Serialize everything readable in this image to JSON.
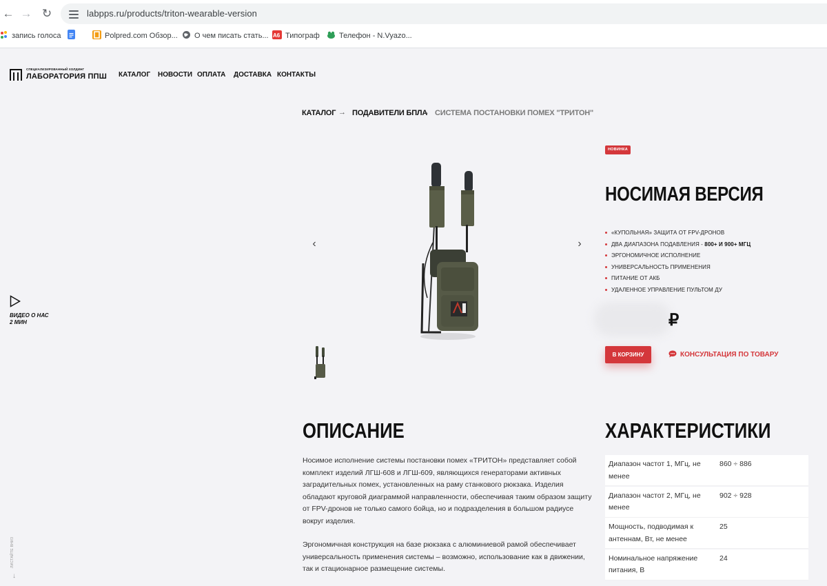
{
  "browser": {
    "url": "labpps.ru/products/triton-wearable-version",
    "bookmarks": [
      {
        "label": "запись голоса",
        "icon": "google-dots-icon"
      },
      {
        "label": "",
        "icon": "google-docs-icon"
      },
      {
        "label": "Polpred.com Обзор...",
        "icon": "polpred-icon"
      },
      {
        "label": "О чем писать стать...",
        "icon": "globe-icon"
      },
      {
        "label": "Типограф",
        "icon": "typograf-icon"
      },
      {
        "label": "Телефон - N.Vyazo...",
        "icon": "frog-icon"
      }
    ]
  },
  "site": {
    "logo_sub": "СПЕЦИАЛИЗИРОВАННЫЙ ХОЛДИНГ",
    "logo_name": "ЛАБОРАТОРИЯ ППШ",
    "menu": [
      "КАТАЛОГ",
      "НОВОСТИ",
      "ОПЛАТА",
      "ДОСТАВКА",
      "КОНТАКТЫ"
    ]
  },
  "breadcrumb": {
    "items": [
      "КАТАЛОГ",
      "ПОДАВИТЕЛИ БПЛА",
      "СИСТЕМА ПОСТАНОВКИ ПОМЕХ \"ТРИТОН\""
    ],
    "separator": "→"
  },
  "video": {
    "label_line1": "ВИДЕО О НАС",
    "label_line2": "2 МИН"
  },
  "scroll_label": "ЛИСТАЙТЕ ВНИЗ",
  "gallery": {
    "prev": "‹",
    "next": "›"
  },
  "product": {
    "badge": "НОВИНКА",
    "title": "НОСИМАЯ ВЕРСИЯ",
    "features": [
      {
        "text": "«КУПОЛЬНАЯ» ЗАЩИТА ОТ FPV-ДРОНОВ",
        "bold": ""
      },
      {
        "text": "ДВА ДИАПАЗОНА ПОДАВЛЕНИЯ - ",
        "bold": "800+ И 900+ МГЦ"
      },
      {
        "text": "ЭРГОНОМИЧНОЕ ИСПОЛНЕНИЕ",
        "bold": ""
      },
      {
        "text": "УНИВЕРСАЛЬНОСТЬ ПРИМЕНЕНИЯ",
        "bold": ""
      },
      {
        "text": "ПИТАНИЕ ОТ АКБ",
        "bold": ""
      },
      {
        "text": "УДАЛЕННОЕ УПРАВЛЕНИЕ ПУЛЬТОМ ДУ",
        "bold": ""
      }
    ],
    "price_currency": "₽",
    "cart_button": "В КОРЗИНУ",
    "consult_link": "КОНСУЛЬТАЦИЯ ПО ТОВАРУ",
    "accent_color": "#d4373b"
  },
  "description": {
    "heading": "ОПИСАНИЕ",
    "paragraphs": [
      "Носимое исполнение системы постановки помех «ТРИТОН» представляет собой комплект изделий ЛГШ-608 и ЛГШ-609, являющихся генераторами активных заградительных помех, установленных на раму станкового рюкзака. Изделия обладают круговой диаграммой направленности, обеспечивая таким образом защиту от FPV-дронов не только самого бойца, но и подразделения в большом радиусе вокруг изделия.",
      "Эргономичная конструкция на базе рюкзака с алюминиевой рамой обеспечивает универсальность применения системы – возможно, использование как в движении, так и стационарное размещение системы."
    ]
  },
  "specs": {
    "heading": "ХАРАКТЕРИСТИКИ",
    "rows": [
      {
        "name": "Диапазон частот 1, МГц, не менее",
        "value": "860 ÷ 886"
      },
      {
        "name": "Диапазон частот 2, МГц, не менее",
        "value": "902 ÷ 928"
      },
      {
        "name": "Мощность, подводимая к антеннам, Вт, не менее",
        "value": "25"
      },
      {
        "name": "Номинальное напряжение питания, В",
        "value": "24"
      }
    ]
  }
}
